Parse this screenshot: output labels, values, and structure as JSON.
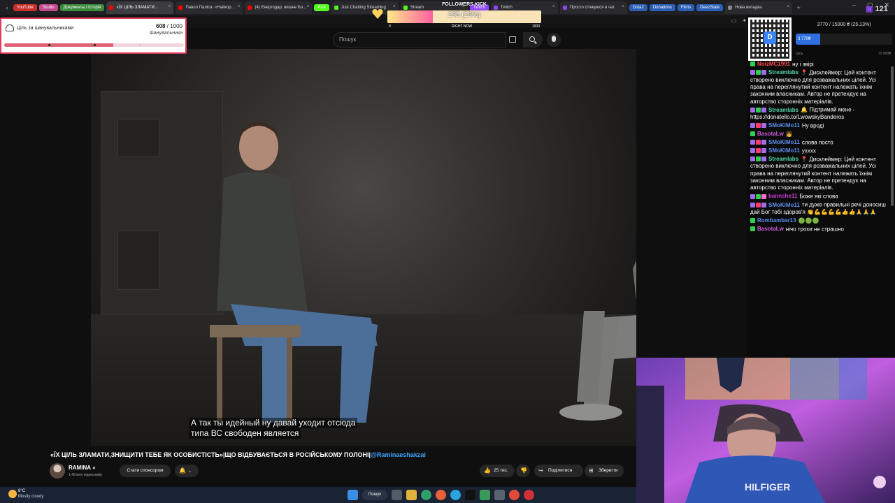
{
  "browser": {
    "bookmarks": [
      {
        "label": "YouTube",
        "color": "#c9302c"
      },
      {
        "label": "Studio",
        "color": "#c24a8c"
      },
      {
        "label": "Документы і історія",
        "color": "#3b8a3b"
      }
    ],
    "tabs": [
      {
        "label": "«ЇХ ЦІЛЬ ЗЛАМАТИ...",
        "active": true,
        "fav": "#ff0000"
      },
      {
        "label": "Павло Паліса: «Найкор...",
        "active": false,
        "fav": "#ff0000"
      },
      {
        "label": "(4) Енергодар, вишне Бо...",
        "active": false,
        "fav": "#ff0000"
      },
      {
        "label": "Just Chatting Streaming",
        "active": false,
        "fav": "#53fc18"
      },
      {
        "label": "Stream",
        "active": false,
        "fav": "#53fc18"
      },
      {
        "label": "Twitch",
        "active": false,
        "fav": "#9146ff"
      },
      {
        "label": "Просто стінкуюся в чат",
        "active": false,
        "fav": "#9146ff"
      },
      {
        "label": "Нова вкладка",
        "active": false,
        "fav": "#888888"
      }
    ],
    "extra_chips": [
      {
        "label": "Dota2",
        "color": "#2b5fb5"
      },
      {
        "label": "Donations",
        "color": "#2b5fb5"
      },
      {
        "label": "Films",
        "color": "#2b5fb5"
      },
      {
        "label": "DeezState",
        "color": "#2b5fb5"
      }
    ],
    "kick_chip": {
      "label": "Kick",
      "color": "#53fc18"
    },
    "twitch_chip": {
      "label": "Twitch",
      "color": "#9146ff"
    }
  },
  "youtube": {
    "search_placeholder": "Пошук",
    "subtitle_lines": [
      "А так ты идейный ну давай уходит отсюда",
      "типа ВС свободен является"
    ],
    "title": "«ЇХ ЦІЛЬ ЗЛАМАТИ,ЗНИЩИТИ ТЕБЕ ЯК ОСОБИСТІСТЬ»|ЩО ВІДБУВАЄТЬСЯ В РОСІЙСЬКОМУ ПОЛОНІ|",
    "title_tag": "@Raminaeshakzai",
    "channel_name": "RAMINA",
    "channel_subs": "1,49 млн підписників",
    "sponsor_label": "Стати спонсором",
    "likes": "25 тис.",
    "share_label": "Поділитися",
    "save_label": "Зберегти"
  },
  "overlays": {
    "goal": {
      "label": "Ціль за шанувальниками",
      "current": "608",
      "total": "/ 1000",
      "sublabel": "Шанувальники",
      "progress": 0.608
    },
    "followers": {
      "title": "FOLLOWERS KICK",
      "value": "295 (29%)",
      "progress": 0.295,
      "min": "0",
      "mid": "RIGHT NOW",
      "max": "1000"
    },
    "donation": {
      "text": "3770 / 15000 ₴ (25.13%)",
      "fill_label": "3 770₴",
      "progress": 0.2513,
      "min": "Ціль",
      "max": "15 000₴"
    },
    "qr_badge": "D",
    "viewers": "121"
  },
  "chat": [
    {
      "user": "NoizMC1991",
      "color": "#ff4a4a",
      "text": "ну і звірі",
      "badges": [
        "#2bd24b"
      ]
    },
    {
      "user": "Streamlabs",
      "color": "#53d8a8",
      "text": "📍 Дисклеймер: Цей контент створено виключно для розважальних цілей. Усі права на переглянутий контент належать їхнім законним власникам. Автор не претендує на авторство сторонніх матеріалів.",
      "badges": [
        "#a26cf0",
        "#2bd24b",
        "#a26cf0"
      ]
    },
    {
      "user": "Streamlabs",
      "color": "#53d8a8",
      "text": "🔔 Підтримай мене - https://donatello.to/LwowskyBanderos",
      "badges": [
        "#a26cf0",
        "#2bd24b",
        "#a26cf0"
      ]
    },
    {
      "user": "SMoKiMo11",
      "color": "#5c8ff2",
      "text": "Ну вроді",
      "badges": [
        "#a26cf0",
        "#ff3b6b",
        "#a26cf0"
      ]
    },
    {
      "user": "BasotaLw",
      "color": "#d05ee0",
      "text": "👧",
      "badges": [
        "#2bd24b"
      ]
    },
    {
      "user": "SMoKiMo11",
      "color": "#5c8ff2",
      "text": "слова посто",
      "badges": [
        "#a26cf0",
        "#ff3b6b",
        "#a26cf0"
      ]
    },
    {
      "user": "SMoKiMo11",
      "color": "#5c8ff2",
      "text": "ухххх",
      "badges": [
        "#a26cf0",
        "#ff3b6b",
        "#a26cf0"
      ]
    },
    {
      "user": "Streamlabs",
      "color": "#53d8a8",
      "text": "📍 Дисклеймер: Цей контент створено виключно для розважальних цілей. Усі права на переглянутий контент належать їхнім законним власникам. Автор не претендує на авторство сторонніх матеріалів.",
      "badges": [
        "#a26cf0",
        "#2bd24b",
        "#a26cf0"
      ]
    },
    {
      "user": "bannshe11",
      "color": "#c03ad0",
      "text": "Боже які слова",
      "badges": [
        "#a26cf0",
        "#2bd24b",
        "#ff6ad5"
      ]
    },
    {
      "user": "SMoKiMo11",
      "color": "#5c8ff2",
      "text": "ти дуже правильні речі доносиш дай Бог тобі здоров'я 👏💪💪💪💪👍👍🙏🙏🙏",
      "badges": [
        "#a26cf0",
        "#ff3b6b",
        "#a26cf0"
      ]
    },
    {
      "user": "Rombambar13",
      "color": "#5c8ff2",
      "text": "🟢🟢🟢",
      "badges": [
        "#2bd24b"
      ]
    },
    {
      "user": "BasotaLw",
      "color": "#d05ee0",
      "text": "нічо трохи не страшно",
      "badges": [
        "#2bd24b"
      ]
    }
  ],
  "taskbar": {
    "temperature": "8°C",
    "weather": "Mostly cloudy",
    "search_label": "Пошук"
  },
  "colors": {
    "yt_bg": "#0f0f0f",
    "link": "#3ea6ff",
    "goal_accent": "#e06277"
  }
}
